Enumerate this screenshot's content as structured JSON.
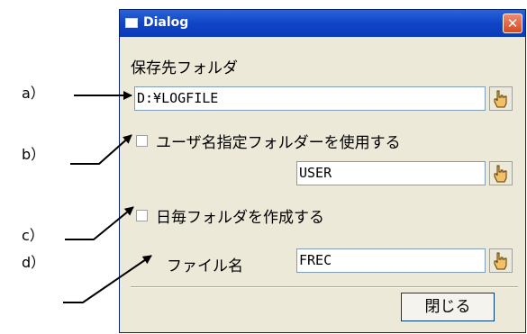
{
  "annotations": [
    "a）",
    "b）",
    "c）",
    "d）"
  ],
  "dialog": {
    "title": "Dialog",
    "close_glyph": "✕",
    "save_folder_label": "保存先フォルダ",
    "save_folder_value": "D:¥LOGFILE",
    "use_user_folder_label": "ユーザ名指定フォルダーを使用する",
    "use_user_folder_checked": false,
    "user_folder_value": "USER",
    "daily_folder_label": "日毎フォルダを作成する",
    "daily_folder_checked": false,
    "file_name_label": "ファイル名",
    "file_name_value": "FREC",
    "close_button_label": "閉じる"
  },
  "icons": {
    "title": "window-icon",
    "picker": "hand-pointer-icon"
  },
  "colors": {
    "titlebar": "#1044c8",
    "close_button": "#d8481f",
    "dialog_background": "#ece9d8"
  }
}
